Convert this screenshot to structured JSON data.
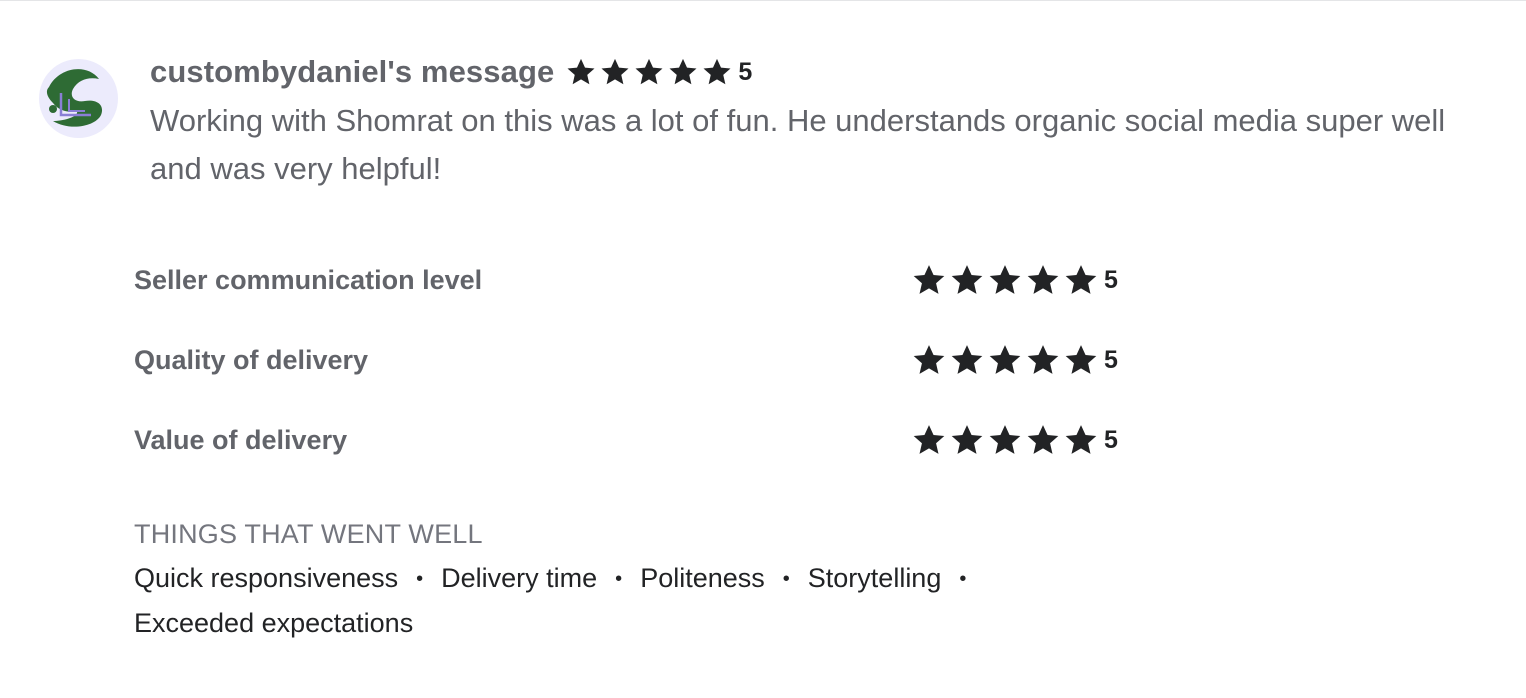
{
  "review": {
    "reviewer_name": "custombydaniel's message",
    "overall_rating": 5,
    "overall_rating_label": "5",
    "message": "Working with Shomrat on this was a lot of fun. He understands organic social media super well and was very helpful!",
    "criteria": [
      {
        "label": "Seller communication level",
        "rating": 5,
        "rating_label": "5"
      },
      {
        "label": "Quality of delivery",
        "rating": 5,
        "rating_label": "5"
      },
      {
        "label": "Value of delivery",
        "rating": 5,
        "rating_label": "5"
      }
    ],
    "tags_title": "THINGS THAT WENT WELL",
    "tags": [
      "Quick responsiveness",
      "Delivery time",
      "Politeness",
      "Storytelling",
      "Exceeded expectations"
    ],
    "star_icon": "star-icon",
    "colors": {
      "star": "#222325",
      "text_muted": "#62646a",
      "text_dark": "#222325",
      "avatar_bg": "#ecebfc",
      "avatar_green": "#2e6b34"
    }
  }
}
